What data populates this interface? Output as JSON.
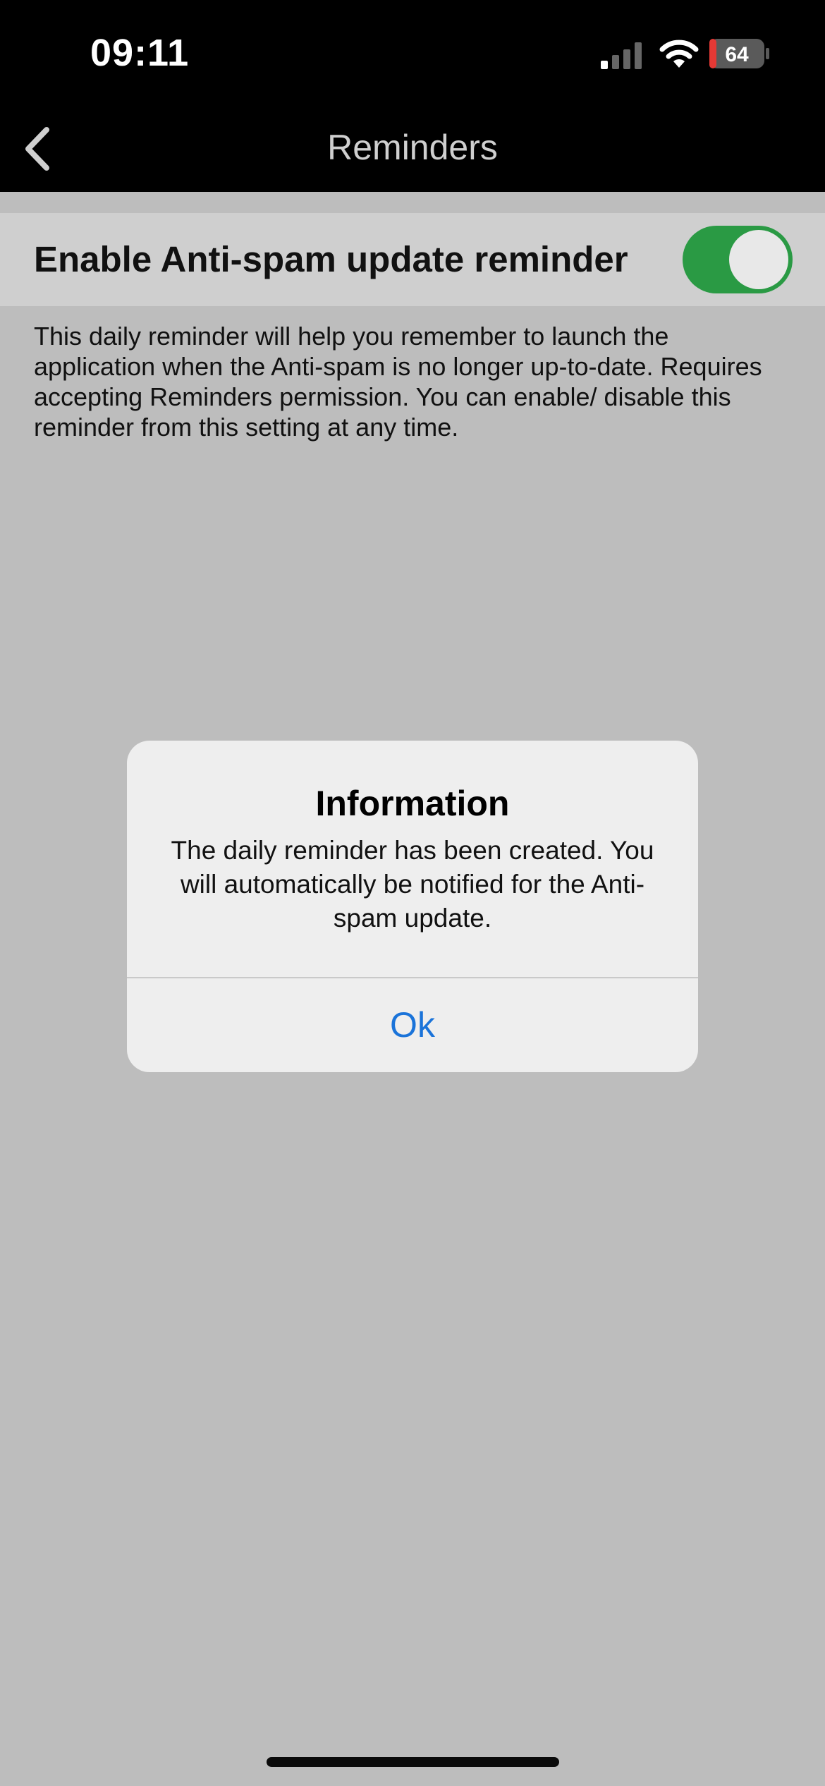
{
  "status_bar": {
    "time": "09:11",
    "battery_level": "64",
    "icons": [
      "signal-icon",
      "wifi-icon",
      "battery-icon"
    ]
  },
  "nav": {
    "title": "Reminders",
    "back_icon": "chevron-left-icon"
  },
  "setting": {
    "label": "Enable Anti-spam update reminder",
    "toggle_on": true,
    "description": "This daily reminder will help you remember to launch the application when the Anti-spam is no longer up-to-date. Requires accepting Reminders permission. You can enable/ disable this reminder from this setting at any time."
  },
  "dialog": {
    "title": "Information",
    "message": "The daily reminder has been created. You will automatically be notified for the Anti-spam update.",
    "ok_label": "Ok"
  },
  "colors": {
    "accent_green": "#2a9a44",
    "button_blue": "#1a73d9"
  }
}
